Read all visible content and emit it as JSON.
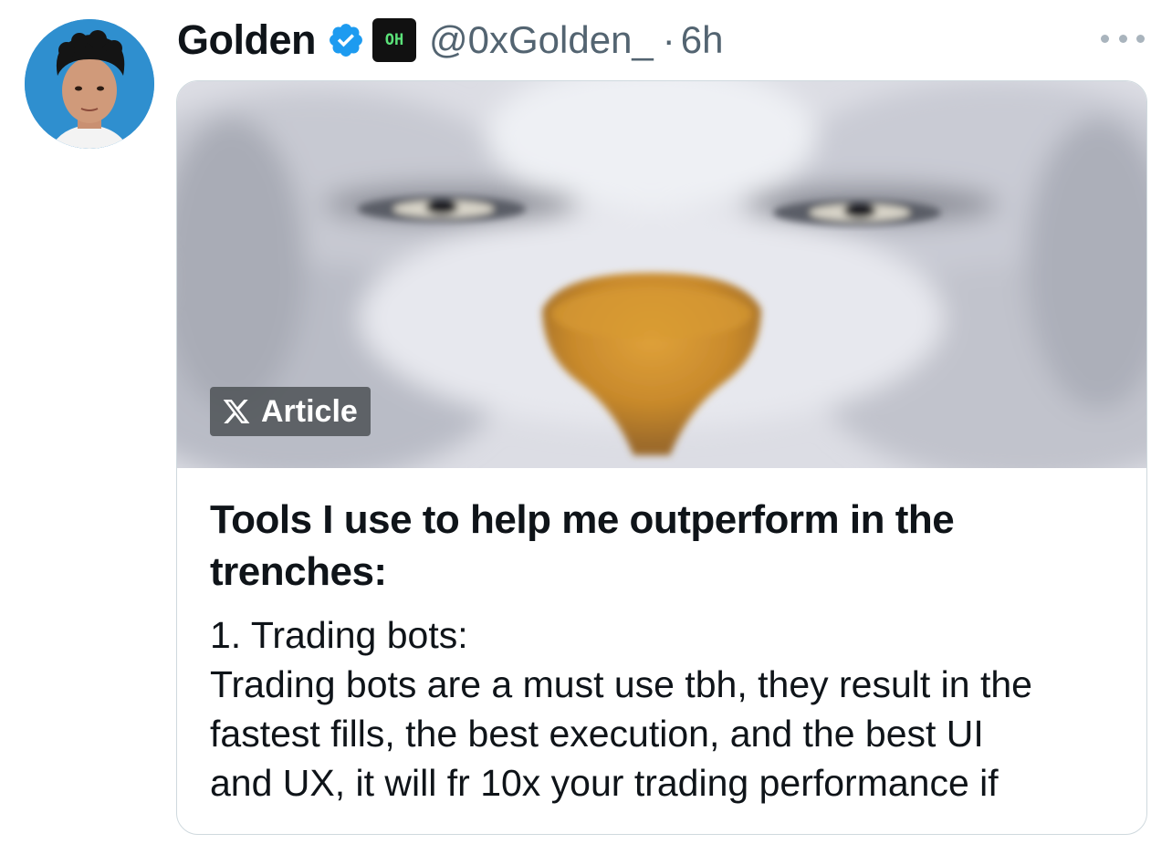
{
  "tweet": {
    "author_name": "Golden",
    "handle": "@0xGolden_",
    "separator": "·",
    "time_ago": "6h",
    "badge_text": "OH",
    "verified_icon": "verified-badge-icon",
    "more_icon": "more-options-icon"
  },
  "article_card": {
    "tag_label": "Article",
    "tag_icon": "x-logo-icon",
    "title": "Tools I use to help me outperform in the trenches:",
    "text_lines": [
      "1. Trading bots:",
      "Trading bots are a must use tbh, they result in the",
      "fastest fills, the best execution, and the best UI",
      "and UX, it will fr 10x your trading performance if"
    ]
  },
  "colors": {
    "verified_blue": "#1d9bf0",
    "secondary_text": "#536471",
    "avatar_bg": "#2f8fcf"
  }
}
